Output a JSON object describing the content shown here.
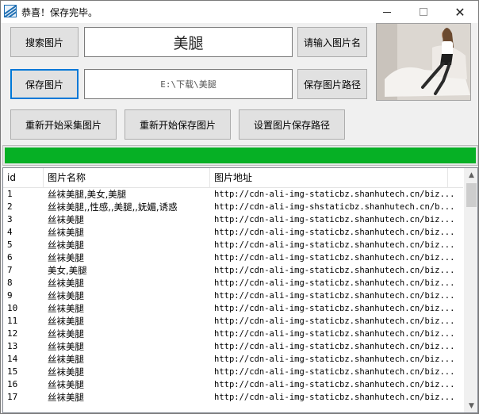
{
  "window": {
    "title": "恭喜！保存完毕。",
    "icon": "app-icon",
    "controls": {
      "minimize": "minimize-icon",
      "maximize": "maximize-icon",
      "close": "✕"
    }
  },
  "toolbar": {
    "search_label": "搜索图片",
    "name_value": "美腿",
    "name_hint_label": "请输入图片名",
    "save_label": "保存图片",
    "path_value": "E:\\下载\\美腿",
    "path_label": "保存图片路径",
    "restart_collect_label": "重新开始采集图片",
    "restart_save_label": "重新开始保存图片",
    "set_path_label": "设置图片保存路径"
  },
  "progress": {
    "value_percent": 100,
    "color": "#06b025"
  },
  "list": {
    "columns": [
      "id",
      "图片名称",
      "图片地址"
    ],
    "rows": [
      {
        "id": "1",
        "name": "丝袜美腿,美女,美腿",
        "url": "http://cdn-ali-img-staticbz.shanhutech.cn/biz..."
      },
      {
        "id": "2",
        "name": "丝袜美腿,,性感,,美腿,,妩媚,诱惑",
        "url": "http://cdn-ali-img-shstaticbz.shanhutech.cn/b..."
      },
      {
        "id": "3",
        "name": "丝袜美腿",
        "url": "http://cdn-ali-img-staticbz.shanhutech.cn/biz..."
      },
      {
        "id": "4",
        "name": "丝袜美腿",
        "url": "http://cdn-ali-img-staticbz.shanhutech.cn/biz..."
      },
      {
        "id": "5",
        "name": "丝袜美腿",
        "url": "http://cdn-ali-img-staticbz.shanhutech.cn/biz..."
      },
      {
        "id": "6",
        "name": "丝袜美腿",
        "url": "http://cdn-ali-img-staticbz.shanhutech.cn/biz..."
      },
      {
        "id": "7",
        "name": "美女,美腿",
        "url": "http://cdn-ali-img-staticbz.shanhutech.cn/biz..."
      },
      {
        "id": "8",
        "name": "丝袜美腿",
        "url": "http://cdn-ali-img-staticbz.shanhutech.cn/biz..."
      },
      {
        "id": "9",
        "name": "丝袜美腿",
        "url": "http://cdn-ali-img-staticbz.shanhutech.cn/biz..."
      },
      {
        "id": "10",
        "name": "丝袜美腿",
        "url": "http://cdn-ali-img-staticbz.shanhutech.cn/biz..."
      },
      {
        "id": "11",
        "name": "丝袜美腿",
        "url": "http://cdn-ali-img-staticbz.shanhutech.cn/biz..."
      },
      {
        "id": "12",
        "name": "丝袜美腿",
        "url": "http://cdn-ali-img-staticbz.shanhutech.cn/biz..."
      },
      {
        "id": "13",
        "name": "丝袜美腿",
        "url": "http://cdn-ali-img-staticbz.shanhutech.cn/biz..."
      },
      {
        "id": "14",
        "name": "丝袜美腿",
        "url": "http://cdn-ali-img-staticbz.shanhutech.cn/biz..."
      },
      {
        "id": "15",
        "name": "丝袜美腿",
        "url": "http://cdn-ali-img-staticbz.shanhutech.cn/biz..."
      },
      {
        "id": "16",
        "name": "丝袜美腿",
        "url": "http://cdn-ali-img-staticbz.shanhutech.cn/biz..."
      },
      {
        "id": "17",
        "name": "丝袜美腿",
        "url": "http://cdn-ali-img-staticbz.shanhutech.cn/biz..."
      }
    ]
  },
  "scrollbar": {
    "up_icon": "▲",
    "down_icon": "▼"
  }
}
